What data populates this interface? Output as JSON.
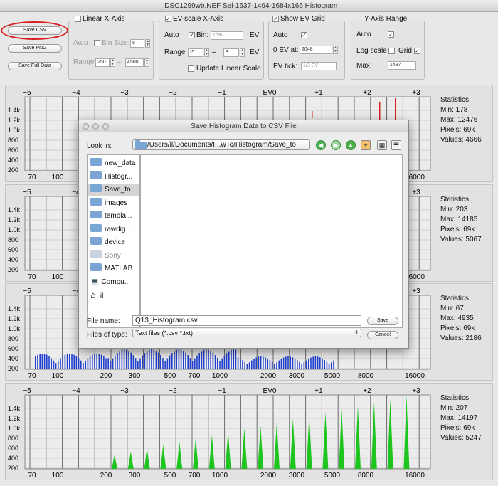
{
  "window": {
    "title": "_DSC1299wb.NEF Sel-1637-1494-1684x166 Histogram"
  },
  "buttons": {
    "save_csv": "Save CSV",
    "save_png": "Save PNG",
    "save_full": "Save Full Data"
  },
  "linear_axis": {
    "title": "Linear X-Axis",
    "checked": false,
    "auto_label": "Auto",
    "bin_size_label": "Bin Size:",
    "bin_size": "8",
    "range_label": "Range:",
    "range_from": "250",
    "range_sep": "–",
    "range_to": "4500"
  },
  "ev_axis": {
    "title": "EV-scale X-Axis",
    "checked": true,
    "auto_label": "Auto",
    "bin_label": "Bin:",
    "bin_value": "1/96",
    "bin_unit": "EV",
    "range_label": "Range",
    "range_from": "-5",
    "range_sep": "–",
    "range_to": "3",
    "range_unit": "EV",
    "update_label": "Update Linear Scale"
  },
  "ev_grid": {
    "title": "Show EV Grid",
    "checked": true,
    "auto_label": "Auto",
    "ev0_label": "0 EV at:",
    "ev0_value": "2048",
    "tick_label": "EV tick:",
    "tick_value": "1/3 EV"
  },
  "y_axis": {
    "title": "Y-Axis Range",
    "auto_label": "Auto",
    "log_label": "Log scale",
    "grid_label": "Grid",
    "max_label": "Max",
    "max_value": "1437"
  },
  "top_ticks": [
    {
      "label": "−5",
      "x": 37
    },
    {
      "label": "−4",
      "x": 106
    },
    {
      "label": "−3",
      "x": 174
    },
    {
      "label": "−2",
      "x": 242
    },
    {
      "label": "−1",
      "x": 311
    },
    {
      "label": "EV0",
      "x": 378
    },
    {
      "label": "+1",
      "x": 447
    },
    {
      "label": "+2",
      "x": 515
    },
    {
      "label": "+3",
      "x": 584
    }
  ],
  "bottom_ticks": [
    {
      "label": "70",
      "x": 44
    },
    {
      "label": "100",
      "x": 80
    },
    {
      "label": "200",
      "x": 148
    },
    {
      "label": "300",
      "x": 188
    },
    {
      "label": "500",
      "x": 238
    },
    {
      "label": "700",
      "x": 272
    },
    {
      "label": "1000",
      "x": 308
    },
    {
      "label": "2000",
      "x": 376
    },
    {
      "label": "3000",
      "x": 416
    },
    {
      "label": "5000",
      "x": 466
    },
    {
      "label": "8000",
      "x": 513
    },
    {
      "label": "16000",
      "x": 582
    }
  ],
  "y_ticks": [
    "1.4k",
    "1.2k",
    "1.0k",
    "800",
    "600",
    "400",
    "200"
  ],
  "panels": [
    {
      "color": "#d42020",
      "stats": {
        "title": "Statistics",
        "min": "Min: 178",
        "max": "Max: 12476",
        "pixels": "Pixels: 69k",
        "values": "Values: 4666"
      }
    },
    {
      "color": "#888888",
      "stats": {
        "title": "Statistics",
        "min": "Min: 203",
        "max": "Max: 14185",
        "pixels": "Pixels: 69k",
        "values": "Values: 5067"
      }
    },
    {
      "color": "#1f3fd0",
      "stats": {
        "title": "Statistics",
        "min": "Min: 67",
        "max": "Max: 4935",
        "pixels": "Pixels: 69k",
        "values": "Values: 2186"
      }
    },
    {
      "color": "#1fc51f",
      "stats": {
        "title": "Statistics",
        "min": "Min: 207",
        "max": "Max: 14197",
        "pixels": "Pixels: 69k",
        "values": "Values: 5247"
      }
    }
  ],
  "dialog": {
    "title": "Save Histogram Data to CSV File",
    "look_in_label": "Look in:",
    "look_in_path": "/Users/il/Documents/I...wTo/Histogram/Save_to",
    "sidebar": [
      "new_data",
      "Histogr...",
      "Save_to",
      "images",
      "templa...",
      "rawdig...",
      "device",
      "Sony",
      "MATLAB",
      "Compu...",
      "il"
    ],
    "file_name_label": "File name:",
    "file_name": "Q13_Histogram.csv",
    "file_type_label": "Files of type:",
    "file_type": "Text files (*.csv *.txt)",
    "save_label": "Save",
    "cancel_label": "Cancel"
  }
}
